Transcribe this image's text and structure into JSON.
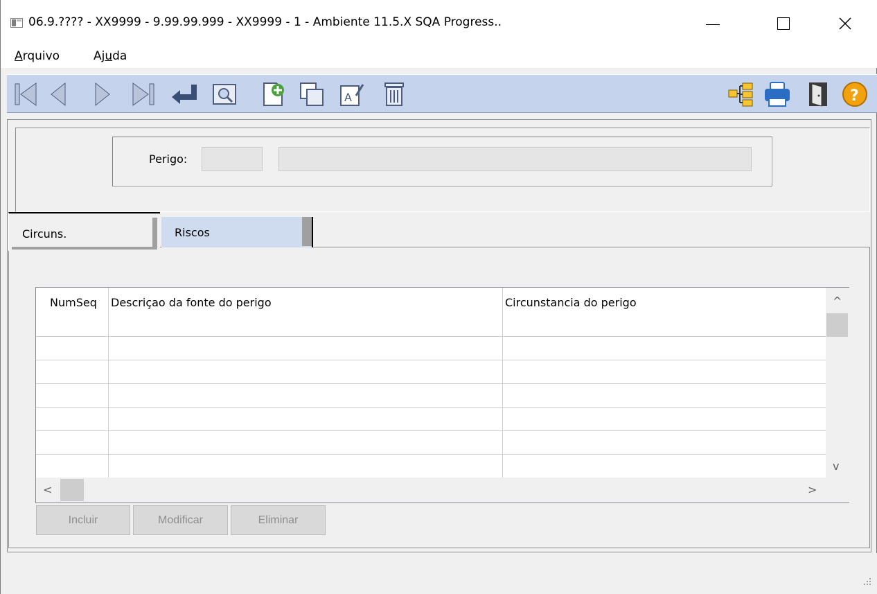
{
  "window": {
    "title": "06.9.???? - XX9999 - 9.99.99.999 - XX9999 - 1 - Ambiente 11.5.X SQA Progress..",
    "minimize_glyph": "—",
    "close_glyph": "✕"
  },
  "menu": {
    "items": [
      {
        "label_first": "A",
        "label_rest": "rquivo"
      },
      {
        "label_first": "Aj",
        "label_u": "u",
        "label_rest": "da"
      }
    ]
  },
  "toolbar": {
    "icons": [
      "first-record-icon",
      "previous-record-icon",
      "next-record-icon",
      "last-record-icon",
      "go-to-icon",
      "search-icon",
      "add-icon",
      "copy-icon",
      "edit-icon",
      "delete-icon",
      "tree-icon",
      "print-icon",
      "exit-icon",
      "help-icon"
    ]
  },
  "header": {
    "perigo_label": "Perigo:",
    "perigo_code": "",
    "perigo_description": ""
  },
  "tabs": [
    {
      "label": "Circuns.",
      "active": true
    },
    {
      "label": "Riscos",
      "active": false
    }
  ],
  "grid": {
    "columns": [
      "NumSeq",
      "Descriçao da fonte do perigo",
      "Circunstancia do perigo"
    ],
    "rows": [],
    "scroll_up": "^",
    "scroll_down": "v",
    "scroll_left": "<",
    "scroll_right": ">"
  },
  "buttons": {
    "add": "Incluir",
    "modify": "Modificar",
    "delete": "Eliminar"
  },
  "colors": {
    "toolbar_bg": "#c6d3ec",
    "tab_inactive_bg": "#cfdbef",
    "button_disabled_bg": "#d9d9d9"
  }
}
